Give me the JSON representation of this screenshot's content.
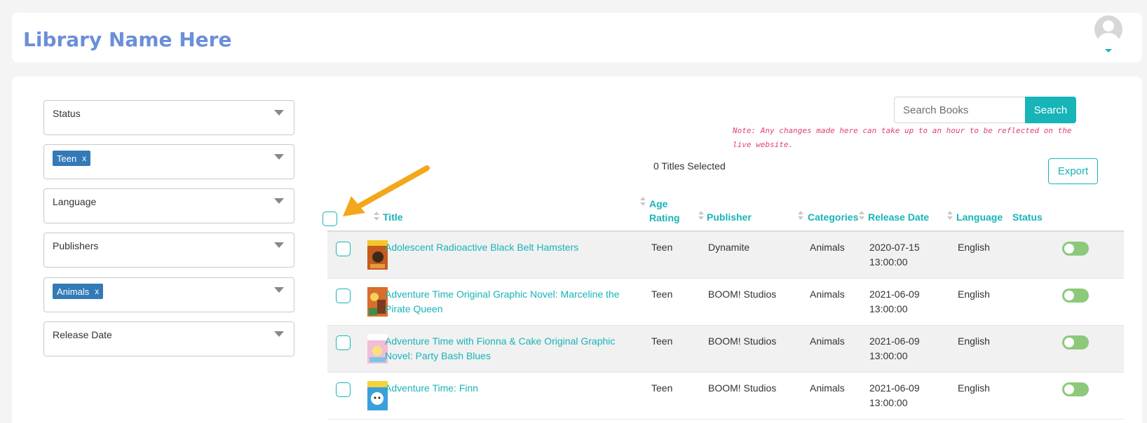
{
  "header": {
    "title": "Library Name Here"
  },
  "filters": [
    {
      "label": "Status",
      "tag": null
    },
    {
      "label": "",
      "tag": "Teen"
    },
    {
      "label": "Language",
      "tag": null
    },
    {
      "label": "Publishers",
      "tag": null
    },
    {
      "label": "",
      "tag": "Animals"
    },
    {
      "label": "Release Date",
      "tag": null
    }
  ],
  "tag_remove": "x",
  "search": {
    "placeholder": "Search Books",
    "button": "Search"
  },
  "note": "Note: Any changes made here can take up to an hour to be reflected on the live website.",
  "selected_count": "0 Titles Selected",
  "export_label": "Export",
  "columns": {
    "title": "Title",
    "age_rating": "Age Rating",
    "publisher": "Publisher",
    "categories": "Categories",
    "release_date": "Release Date",
    "language": "Language",
    "status": "Status"
  },
  "rows": [
    {
      "title": "Adolescent Radioactive Black Belt Hamsters",
      "age_rating": "Teen",
      "publisher": "Dynamite",
      "categories": "Animals",
      "release_date": "2020-07-15 13:00:00",
      "language": "English",
      "cover_color": "#c65a1e"
    },
    {
      "title": "Adventure Time Original Graphic Novel: Marceline the Pirate Queen",
      "age_rating": "Teen",
      "publisher": "BOOM! Studios",
      "categories": "Animals",
      "release_date": "2021-06-09 13:00:00",
      "language": "English",
      "cover_color": "#d86d2c"
    },
    {
      "title": "Adventure Time with Fionna & Cake Original Graphic Novel: Party Bash Blues",
      "age_rating": "Teen",
      "publisher": "BOOM! Studios",
      "categories": "Animals",
      "release_date": "2021-06-09 13:00:00",
      "language": "English",
      "cover_color": "#e9a2c8"
    },
    {
      "title": "Adventure Time: Finn",
      "age_rating": "Teen",
      "publisher": "BOOM! Studios",
      "categories": "Animals",
      "release_date": "2021-06-09 13:00:00",
      "language": "English",
      "cover_color": "#3aa0dc"
    }
  ],
  "colors": {
    "accent": "#17b4b8",
    "brand": "#6b8fd9",
    "tag": "#337ab7",
    "note": "#e0436e",
    "toggle_on": "#8cc97a",
    "arrow": "#f4a71a"
  }
}
